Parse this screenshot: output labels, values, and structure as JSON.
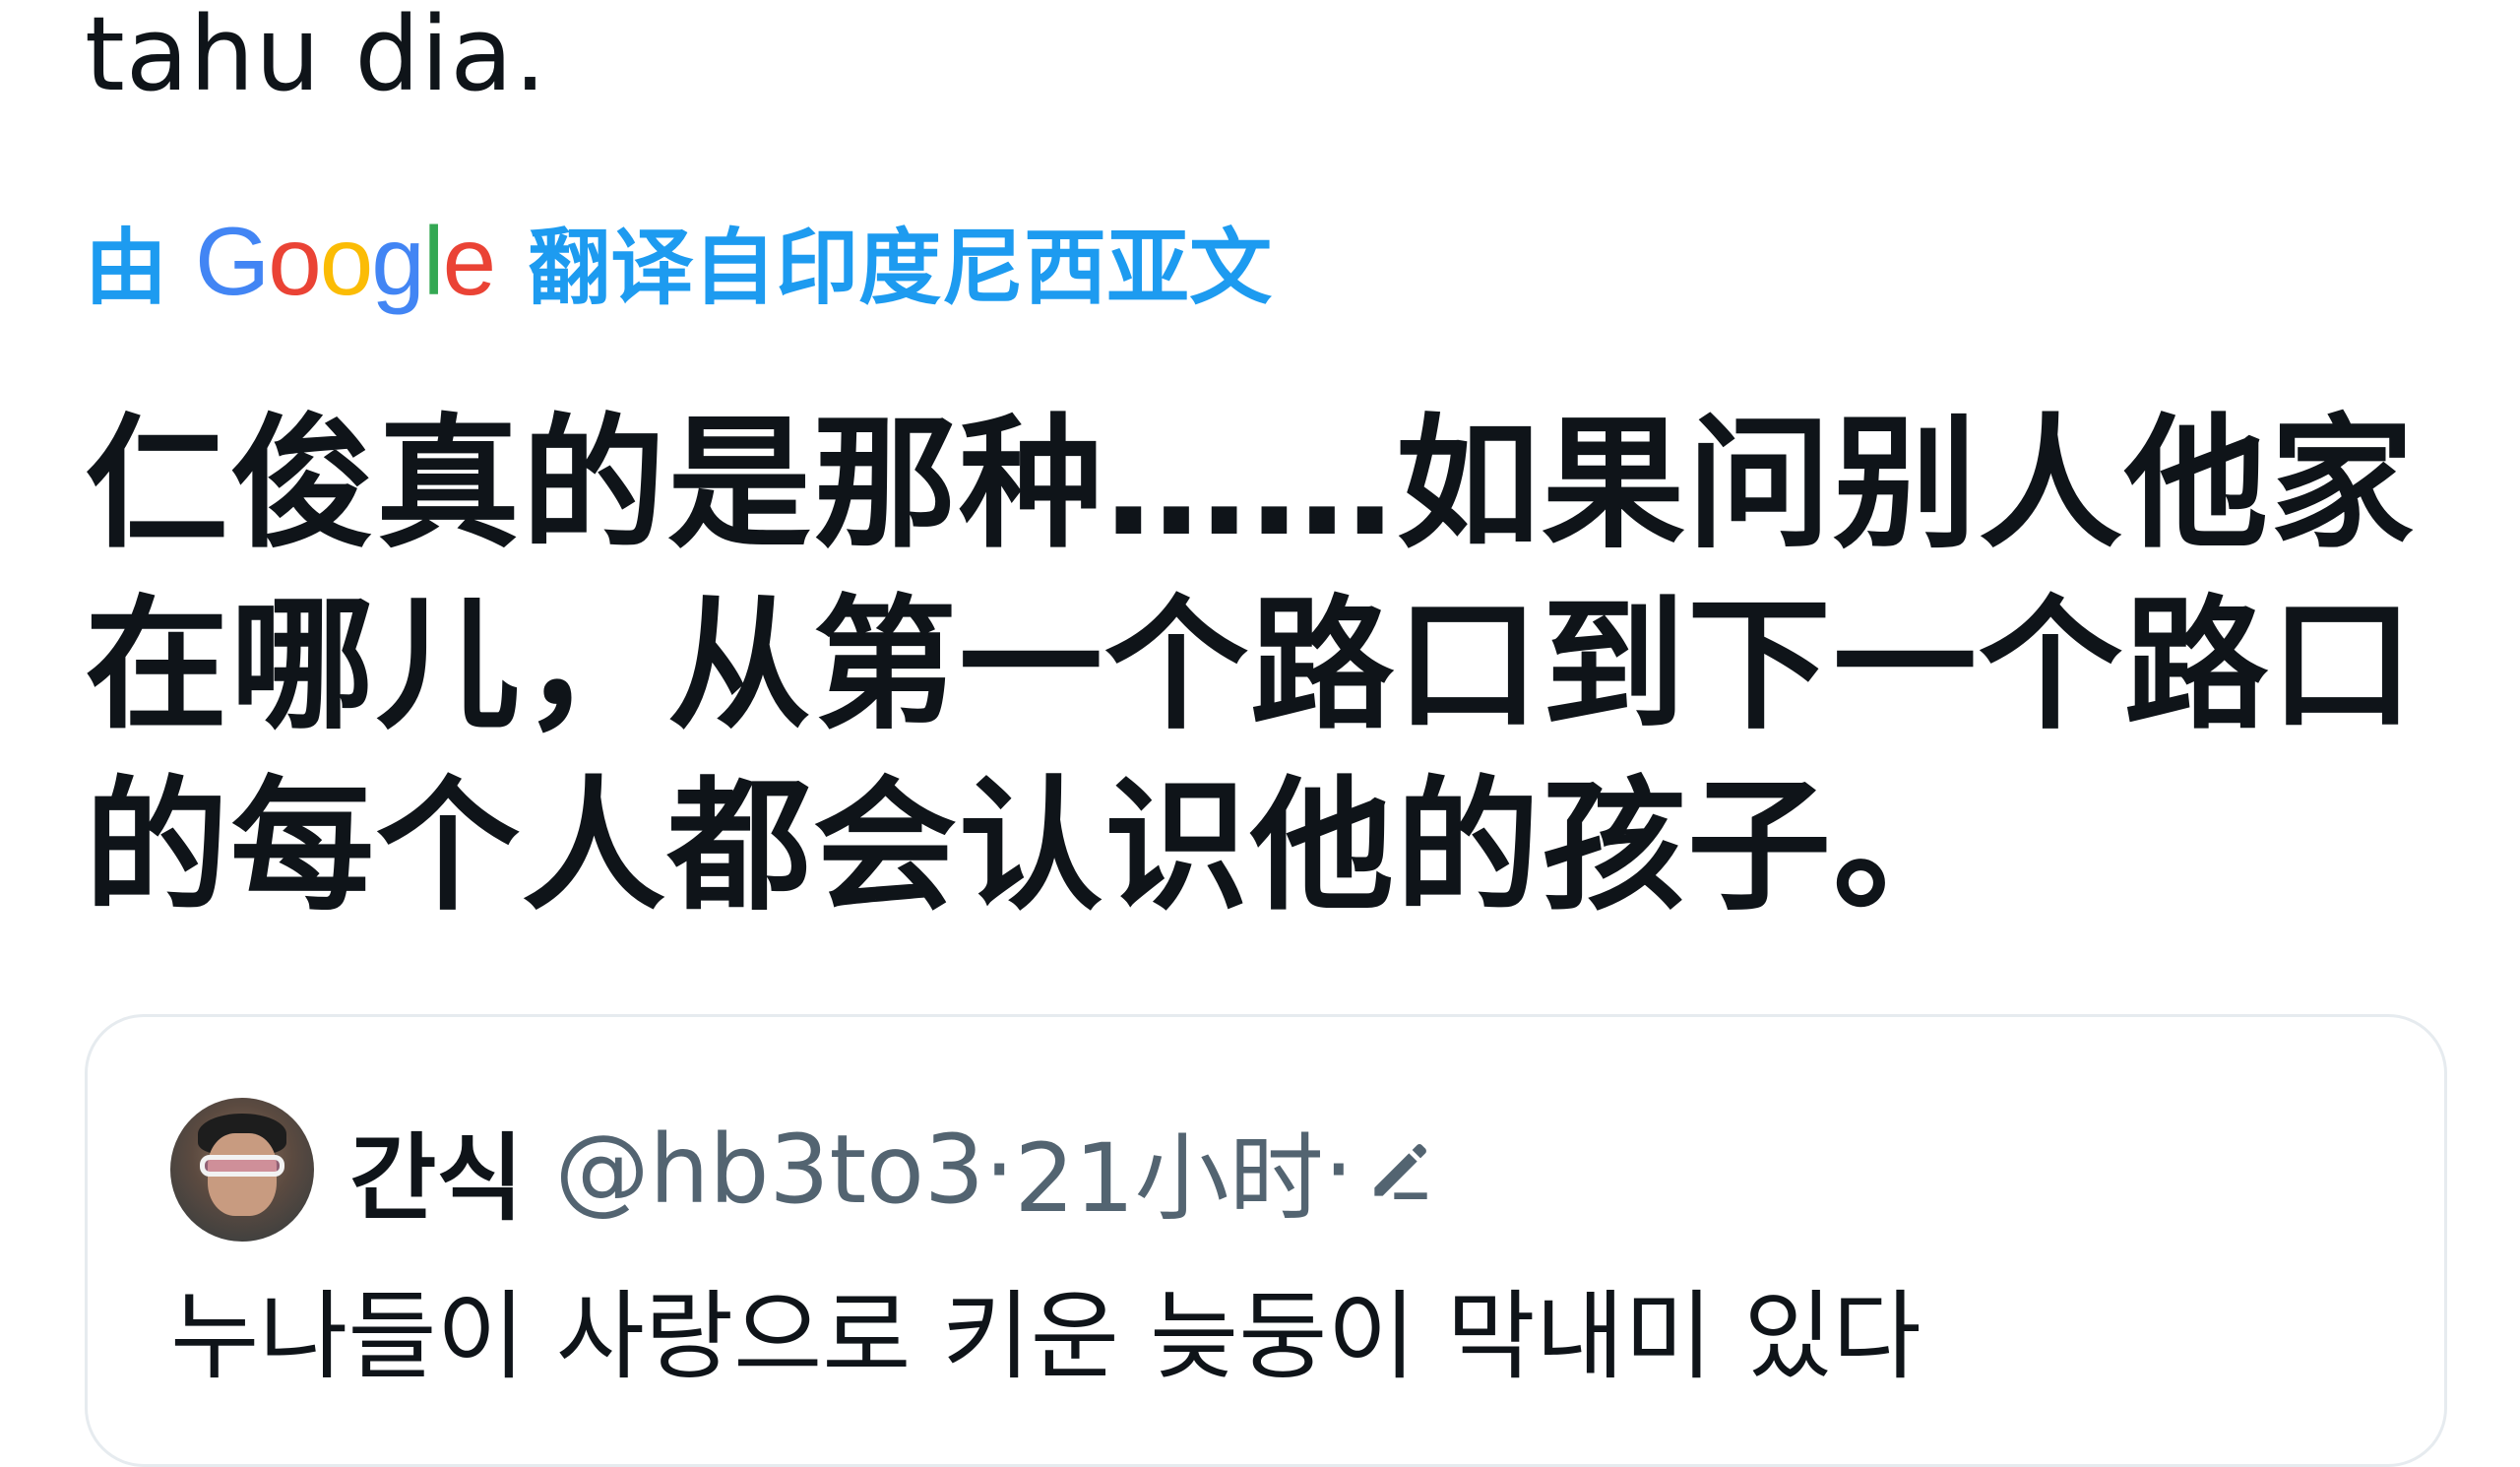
{
  "tweet": {
    "original_tail": "tahu dia.",
    "translation_notice": {
      "prefix": "由",
      "provider_letters": [
        "G",
        "o",
        "o",
        "g",
        "l",
        "e"
      ],
      "provider_colors": [
        "#4285F4",
        "#EA4335",
        "#FBBC05",
        "#4285F4",
        "#34A853",
        "#EA4335"
      ],
      "suffix": "翻译自印度尼西亚文"
    },
    "translated_text": "仁俊真的是那种……如果问别人他家在哪儿，从第一个路口到下一个路口的每个人都会认识他的孩子。"
  },
  "quoted_tweet": {
    "display_name": "간식",
    "handle": "@hb3to3",
    "separator": "·",
    "time": "21小时",
    "edited_icon": "pencil-icon",
    "text": "누나들이 사랑으로 키운 늦둥이 막내미 있다"
  },
  "colors": {
    "link_blue": "#1d9bf0",
    "text_primary": "#0f1419",
    "text_secondary": "#536471",
    "card_border": "#e6ebef"
  }
}
